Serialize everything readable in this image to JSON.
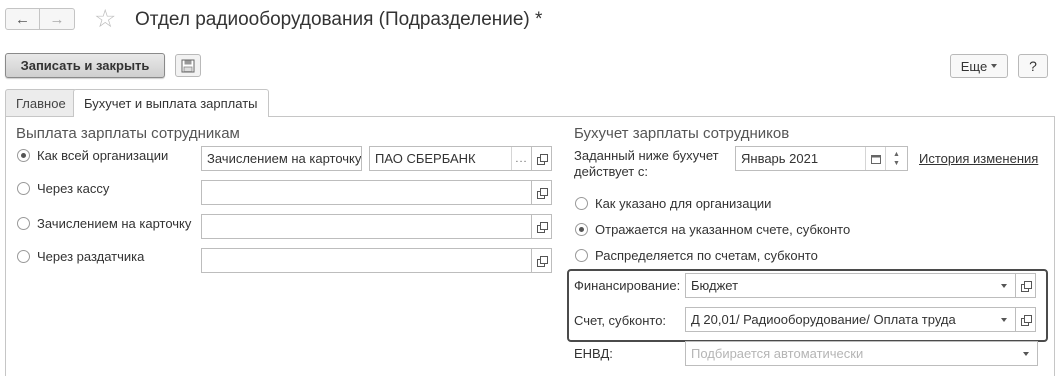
{
  "window": {
    "title": "Отдел радиооборудования (Подразделение) *",
    "back_icon": "←",
    "forward_icon": "→",
    "star_icon": "☆"
  },
  "toolbar": {
    "save_close_label": "Записать и закрыть",
    "more_label": "Еще",
    "help_label": "?"
  },
  "tabs": [
    {
      "label": "Главное"
    },
    {
      "label": "Бухучет и выплата зарплаты"
    }
  ],
  "salary_payment": {
    "title": "Выплата зарплаты сотрудникам",
    "options": [
      {
        "label": "Как всей организации",
        "checked": true
      },
      {
        "label": "Через кассу",
        "checked": false
      },
      {
        "label": "Зачислением на карточку",
        "checked": false
      },
      {
        "label": "Через раздатчика",
        "checked": false
      }
    ],
    "method_value": "Зачислением на карточку",
    "bank_value": "ПАО СБЕРБАНК",
    "ellipsis": "..."
  },
  "accounting": {
    "title": "Бухучет зарплаты сотрудников",
    "effective_label_line1": "Заданный ниже бухучет",
    "effective_label_line2": "действует с:",
    "effective_value": "Январь 2021",
    "history_link": "История изменения",
    "options": [
      {
        "label": "Как указано для организации",
        "checked": false
      },
      {
        "label": "Отражается на указанном счете, субконто",
        "checked": true
      },
      {
        "label": "Распределяется по счетам, субконто",
        "checked": false
      }
    ],
    "financing_label": "Финансирование:",
    "financing_value": "Бюджет",
    "account_label": "Счет, субконто:",
    "account_value": "Д 20,01/ Радиооборудование/ Оплата труда",
    "envd_label": "ЕНВД:",
    "envd_placeholder": "Подбирается автоматически"
  }
}
